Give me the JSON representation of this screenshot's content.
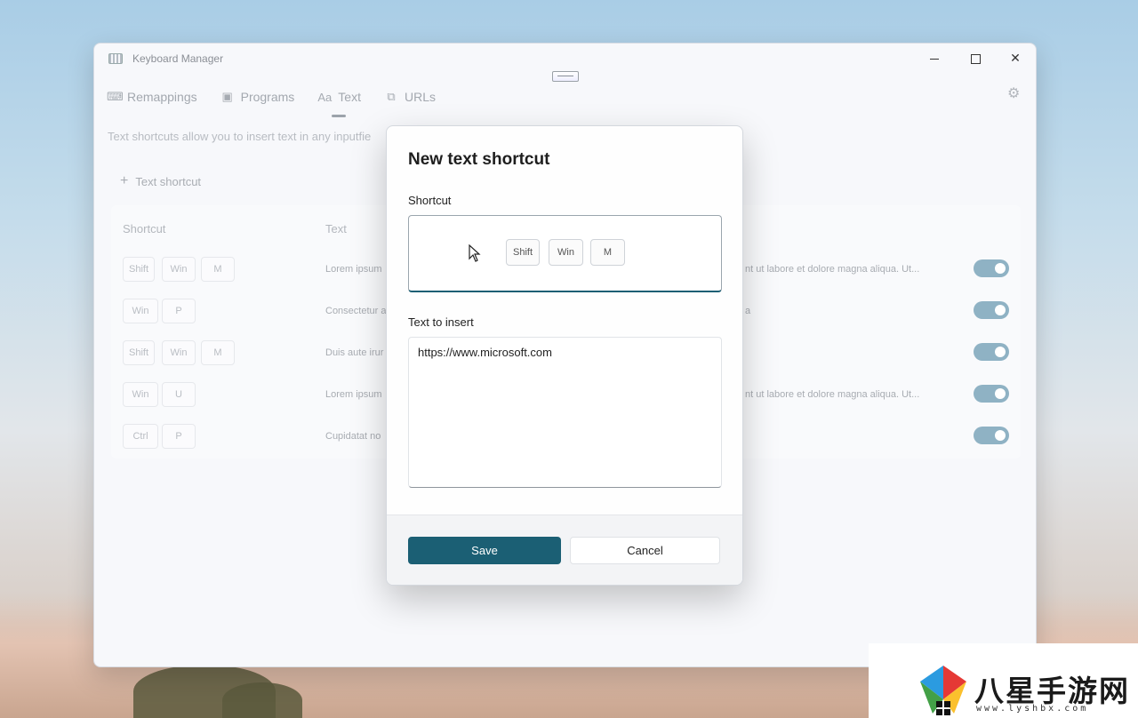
{
  "window": {
    "title": "Keyboard Manager",
    "tabs": [
      {
        "label": "Remappings",
        "icon": "remap-icon"
      },
      {
        "label": "Programs",
        "icon": "programs-icon"
      },
      {
        "label": "Text",
        "icon": "text-icon"
      },
      {
        "label": "URLs",
        "icon": "url-icon"
      }
    ],
    "active_tab": "Text",
    "description": "Text shortcuts allow you to insert text in any inputfie",
    "add_button_label": "Text shortcut",
    "columns": {
      "shortcut": "Shortcut",
      "text": "Text"
    },
    "rows": [
      {
        "keys": [
          "Shift",
          "Win",
          "M"
        ],
        "text": "Lorem ipsum",
        "text_right": "nt ut labore et dolore magna aliqua. Ut...",
        "enabled": true
      },
      {
        "keys": [
          "Win",
          "P"
        ],
        "text": "Consectetur a",
        "text_right": "a",
        "enabled": true
      },
      {
        "keys": [
          "Shift",
          "Win",
          "M"
        ],
        "text": "Duis aute irur",
        "text_right": "",
        "enabled": true
      },
      {
        "keys": [
          "Win",
          "U"
        ],
        "text": "Lorem ipsum",
        "text_right": "nt ut labore et dolore magna aliqua. Ut...",
        "enabled": true
      },
      {
        "keys": [
          "Ctrl",
          "P"
        ],
        "text": "Cupidatat no",
        "text_right": "",
        "enabled": true
      }
    ]
  },
  "dialog": {
    "title": "New text shortcut",
    "shortcut_label": "Shortcut",
    "shortcut_keys": [
      "Shift",
      "Win",
      "M"
    ],
    "text_label": "Text to insert",
    "text_value": "https://www.microsoft.com",
    "save_label": "Save",
    "cancel_label": "Cancel"
  },
  "watermark": {
    "text": "八星手游网",
    "url": "www.lyshbx.com"
  },
  "colors": {
    "accent": "#1b5f74",
    "toggle_on": "#8fb2c4"
  }
}
